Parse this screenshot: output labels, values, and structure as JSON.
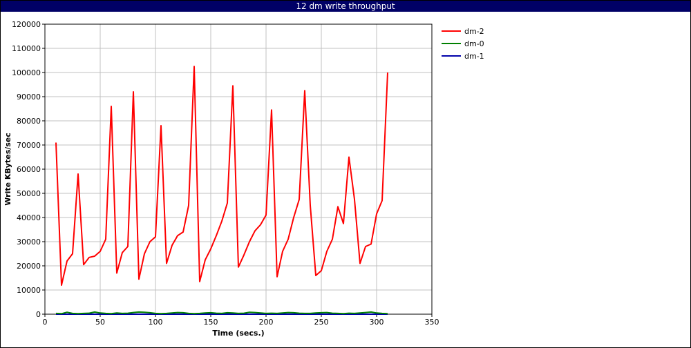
{
  "chart_data": {
    "type": "line",
    "title": "12 dm write throughput",
    "xlabel": "Time (secs.)",
    "ylabel": "Write KBytes/sec",
    "xlim": [
      0,
      350
    ],
    "ylim": [
      0,
      120000
    ],
    "xticks": [
      0,
      50,
      100,
      150,
      200,
      250,
      300,
      350
    ],
    "yticks": [
      0,
      10000,
      20000,
      30000,
      40000,
      50000,
      60000,
      70000,
      80000,
      90000,
      100000,
      110000,
      120000
    ],
    "grid": true,
    "legend_position": "top-right",
    "series": [
      {
        "name": "dm-2",
        "color": "#ff0000",
        "x": [
          10,
          15,
          20,
          25,
          30,
          35,
          40,
          45,
          50,
          55,
          60,
          65,
          70,
          75,
          80,
          85,
          90,
          95,
          100,
          105,
          110,
          115,
          120,
          125,
          130,
          135,
          140,
          145,
          150,
          155,
          160,
          165,
          170,
          175,
          180,
          185,
          190,
          195,
          200,
          205,
          210,
          215,
          220,
          225,
          230,
          235,
          240,
          245,
          250,
          255,
          260,
          265,
          270,
          275,
          280,
          285,
          290,
          295,
          300,
          305,
          310
        ],
        "y": [
          71000,
          12000,
          22000,
          25000,
          58000,
          20500,
          23500,
          24000,
          26000,
          31000,
          86000,
          17000,
          25500,
          28000,
          92000,
          14500,
          25000,
          30000,
          32000,
          78000,
          21000,
          28500,
          32500,
          34000,
          45000,
          102500,
          13500,
          22500,
          27000,
          32500,
          38500,
          46000,
          94500,
          19500,
          24500,
          30000,
          34500,
          37000,
          41000,
          84500,
          15500,
          26000,
          31000,
          40000,
          47500,
          92500,
          45000,
          16000,
          18000,
          26000,
          31000,
          44500,
          37500,
          65000,
          47500,
          21000,
          28000,
          29000,
          41500,
          47000,
          100000
        ]
      },
      {
        "name": "dm-0",
        "color": "#008000",
        "x": [
          10,
          15,
          20,
          25,
          30,
          35,
          40,
          45,
          50,
          55,
          60,
          65,
          70,
          75,
          80,
          85,
          90,
          95,
          100,
          105,
          110,
          115,
          120,
          125,
          130,
          135,
          140,
          145,
          150,
          155,
          160,
          165,
          170,
          175,
          180,
          185,
          190,
          195,
          200,
          205,
          210,
          215,
          220,
          225,
          230,
          235,
          240,
          245,
          250,
          255,
          260,
          265,
          270,
          275,
          280,
          285,
          290,
          295,
          300,
          305,
          310
        ],
        "y": [
          300,
          200,
          800,
          300,
          200,
          300,
          400,
          900,
          500,
          300,
          200,
          500,
          300,
          400,
          700,
          900,
          800,
          600,
          300,
          200,
          300,
          500,
          700,
          600,
          300,
          200,
          300,
          500,
          600,
          400,
          300,
          600,
          500,
          300,
          400,
          800,
          700,
          500,
          300,
          400,
          300,
          500,
          700,
          600,
          400,
          300,
          300,
          500,
          600,
          700,
          400,
          300,
          200,
          400,
          300,
          500,
          700,
          900,
          500,
          300,
          200
        ]
      },
      {
        "name": "dm-1",
        "color": "#0000aa",
        "x": [
          10,
          50,
          100,
          150,
          200,
          250,
          300,
          310
        ],
        "y": [
          0,
          0,
          0,
          0,
          0,
          0,
          0,
          0
        ]
      }
    ]
  }
}
